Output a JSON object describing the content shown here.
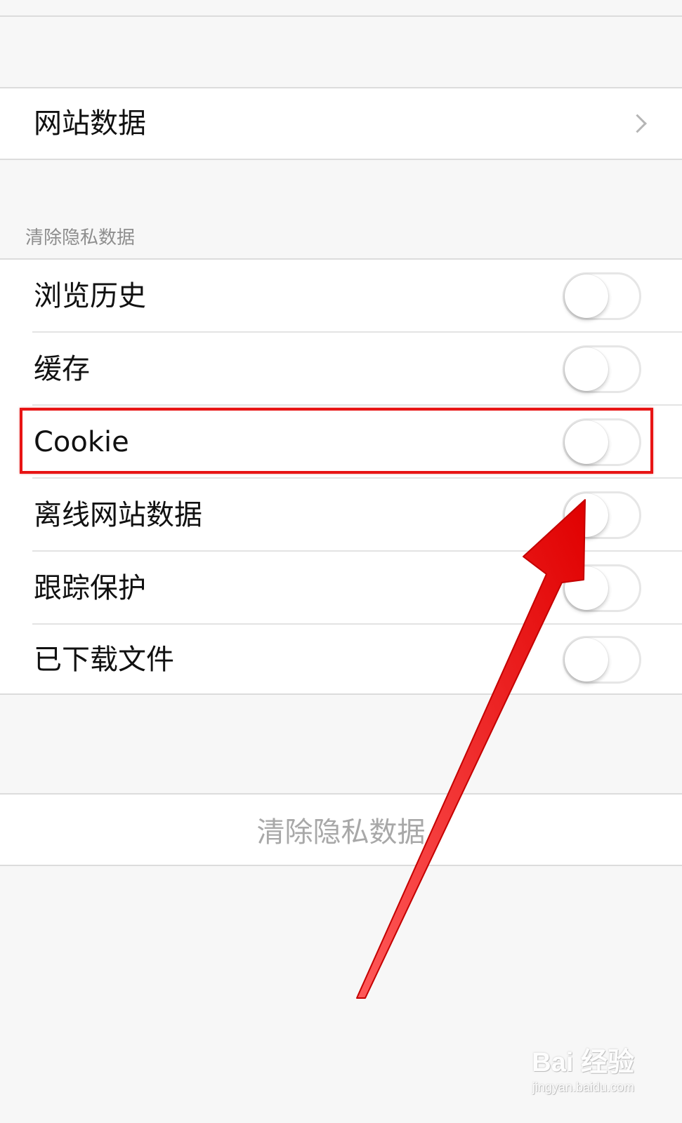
{
  "site_data": {
    "label": "网站数据"
  },
  "clear_section": {
    "header": "清除隐私数据",
    "items": [
      {
        "label": "浏览历史",
        "enabled": false
      },
      {
        "label": "缓存",
        "enabled": false
      },
      {
        "label": "Cookie",
        "enabled": false
      },
      {
        "label": "离线网站数据",
        "enabled": false
      },
      {
        "label": "跟踪保护",
        "enabled": false
      },
      {
        "label": "已下载文件",
        "enabled": false
      }
    ]
  },
  "clear_button": {
    "label": "清除隐私数据"
  },
  "annotation": {
    "highlight_color": "#e81414",
    "arrow_color": "#ee1111"
  },
  "watermark": {
    "brand": "Bai 经验",
    "url": "jingyan.baidu.com"
  },
  "colors": {
    "background": "#f7f7f7",
    "row_background": "#ffffff",
    "separator": "#dcdcdc",
    "secondary_text": "#8e8e8e",
    "disabled_text": "#a8a8a8"
  }
}
